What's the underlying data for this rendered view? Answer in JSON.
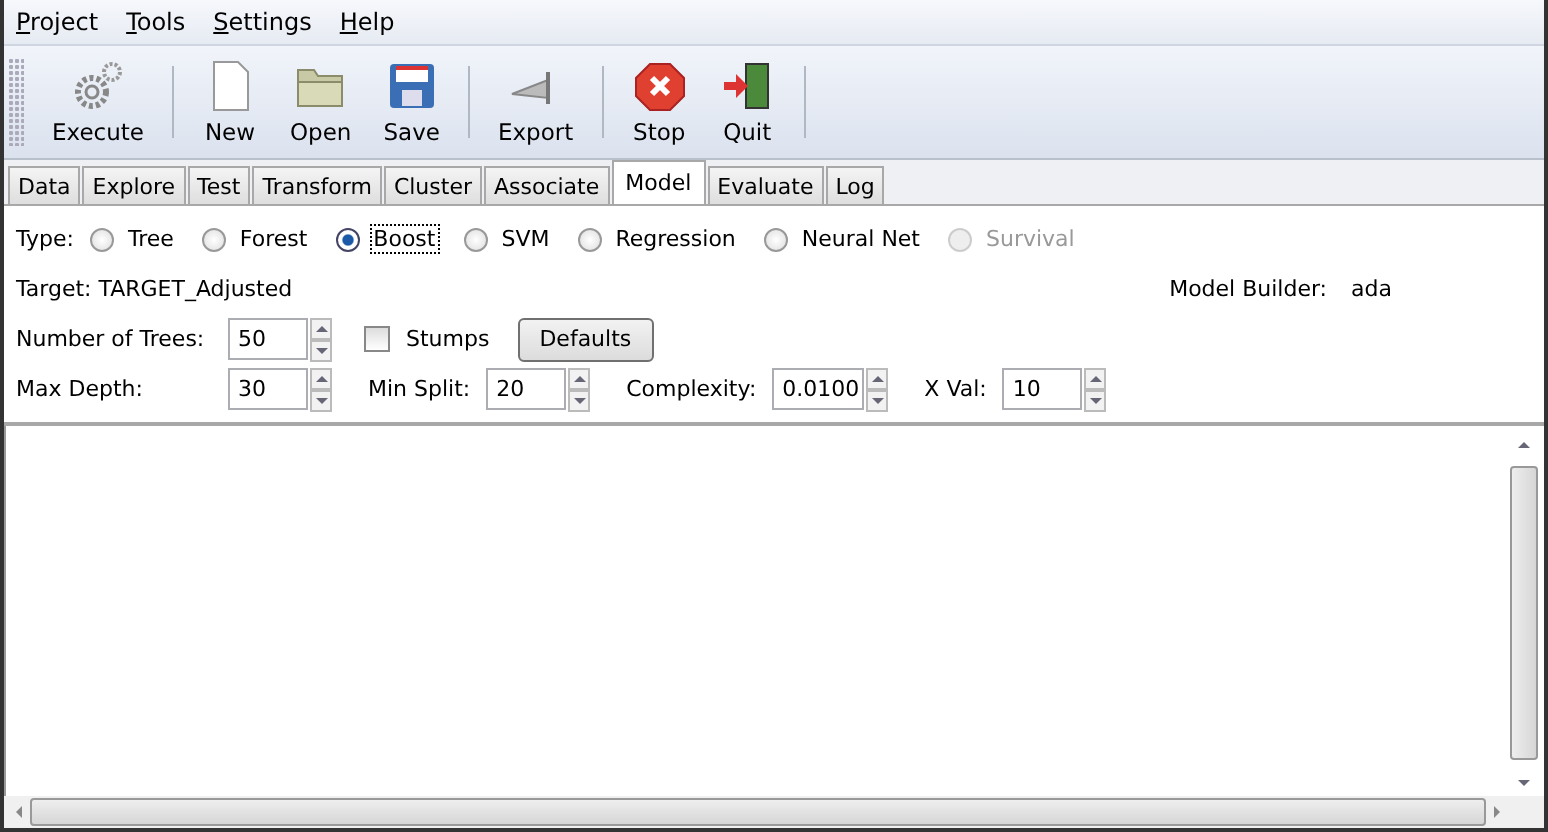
{
  "menu": [
    "Project",
    "Tools",
    "Settings",
    "Help"
  ],
  "toolbar": [
    {
      "label": "Execute"
    },
    {
      "label": "New"
    },
    {
      "label": "Open"
    },
    {
      "label": "Save"
    },
    {
      "label": "Export"
    },
    {
      "label": "Stop"
    },
    {
      "label": "Quit"
    }
  ],
  "tabs": [
    {
      "label": "Data",
      "selected": false
    },
    {
      "label": "Explore",
      "selected": false
    },
    {
      "label": "Test",
      "selected": false
    },
    {
      "label": "Transform",
      "selected": false
    },
    {
      "label": "Cluster",
      "selected": false
    },
    {
      "label": "Associate",
      "selected": false
    },
    {
      "label": "Model",
      "selected": true
    },
    {
      "label": "Evaluate",
      "selected": false
    },
    {
      "label": "Log",
      "selected": false
    }
  ],
  "type_label": "Type:",
  "types": [
    {
      "label": "Tree",
      "selected": false,
      "disabled": false
    },
    {
      "label": "Forest",
      "selected": false,
      "disabled": false
    },
    {
      "label": "Boost",
      "selected": true,
      "disabled": false
    },
    {
      "label": "SVM",
      "selected": false,
      "disabled": false
    },
    {
      "label": "Regression",
      "selected": false,
      "disabled": false
    },
    {
      "label": "Neural Net",
      "selected": false,
      "disabled": false
    },
    {
      "label": "Survival",
      "selected": false,
      "disabled": true
    }
  ],
  "target": "Target: TARGET_Adjusted",
  "builder_label": "Model Builder:",
  "builder_value": "ada",
  "trees_label": "Number of Trees:",
  "trees_value": "50",
  "stumps": {
    "label": "Stumps",
    "checked": false
  },
  "defaults_button": "Defaults",
  "params": [
    {
      "label": "Max Depth:",
      "value": "30"
    },
    {
      "label": "Min Split:",
      "value": "20"
    },
    {
      "label": "Complexity:",
      "value": "0.0100"
    },
    {
      "label": "X Val:",
      "value": "10"
    }
  ]
}
